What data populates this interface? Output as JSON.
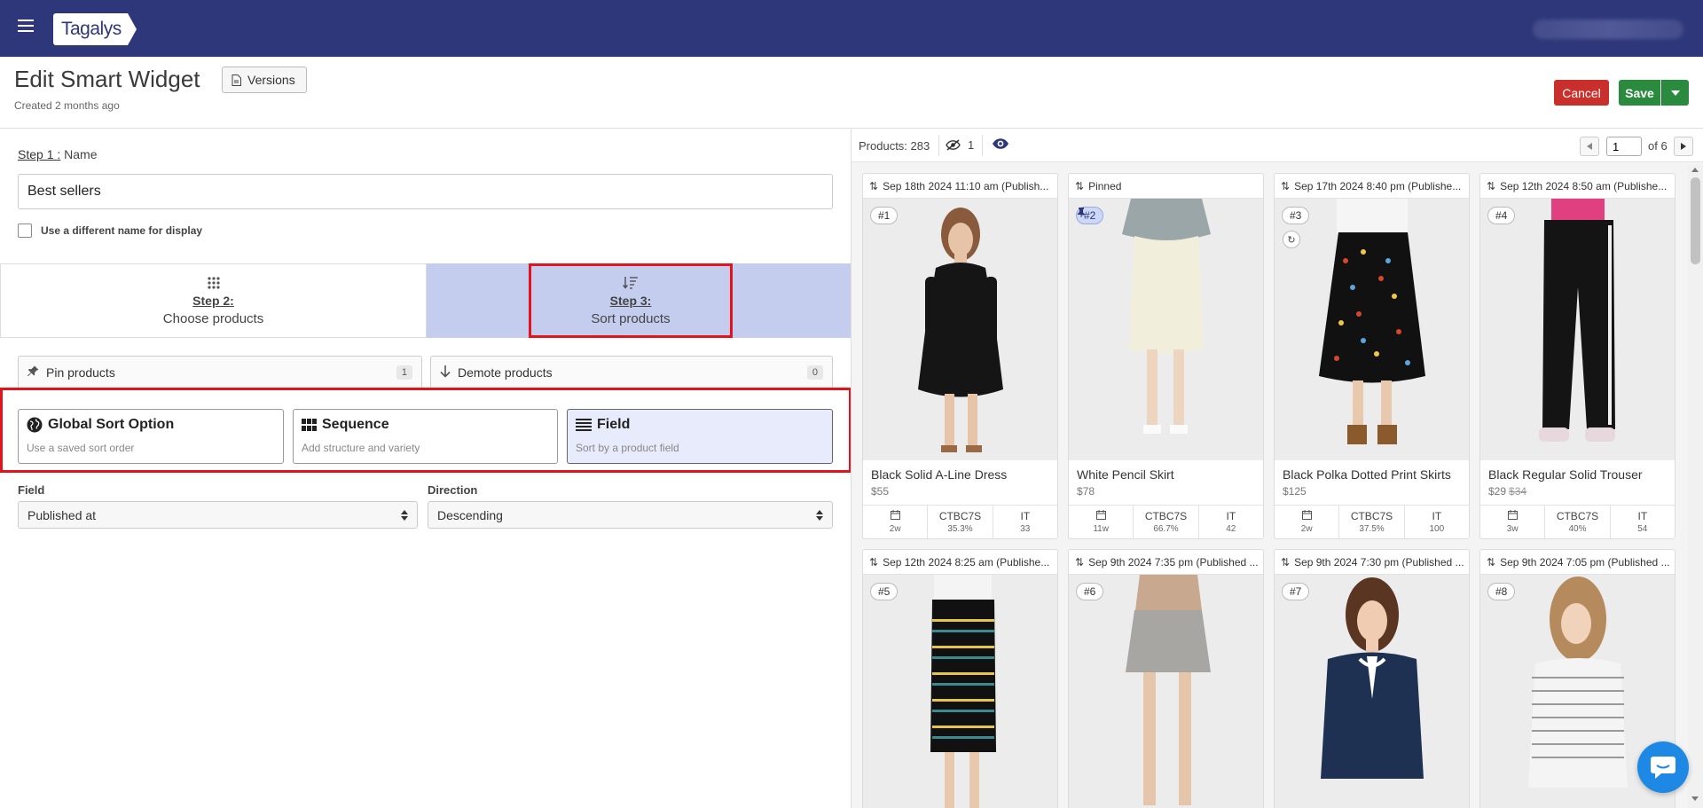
{
  "app": {
    "logo": "Tagalys"
  },
  "header": {
    "title": "Edit Smart Widget",
    "versions_label": "Versions",
    "created": "Created 2 months ago",
    "cancel_label": "Cancel",
    "save_label": "Save"
  },
  "step1": {
    "step_label": "Step 1 :",
    "label": "Name",
    "name_value": "Best sellers",
    "display_name_checkbox": "Use a different name for display"
  },
  "steps": [
    {
      "title": "Step 2:",
      "subtitle": "Choose products"
    },
    {
      "title": "Step 3:",
      "subtitle": "Sort products"
    }
  ],
  "pin_demote": [
    {
      "label": "Pin products",
      "count": "1"
    },
    {
      "label": "Demote products",
      "count": "0"
    }
  ],
  "sort_options": [
    {
      "title": "Global Sort Option",
      "subtitle": "Use a saved sort order"
    },
    {
      "title": "Sequence",
      "subtitle": "Add structure and variety"
    },
    {
      "title": "Field",
      "subtitle": "Sort by a product field"
    }
  ],
  "sort_config": {
    "field_label": "Field",
    "field_value": "Published at",
    "direction_label": "Direction",
    "direction_value": "Descending"
  },
  "product_bar": {
    "products_label": "Products:",
    "products_count": "283",
    "hidden_count": "1",
    "page_value": "1",
    "page_of": "of 6"
  },
  "products": [
    {
      "header": "Sep 18th 2024 11:10 am (Publish...",
      "rank": "#1",
      "name": "Black Solid A-Line Dress",
      "price": "$55",
      "old_price": "",
      "age": "2w",
      "ctbc": "35.3%",
      "it": "33"
    },
    {
      "header": "Pinned",
      "rank": "#2",
      "name": "White Pencil Skirt",
      "price": "$78",
      "old_price": "",
      "age": "11w",
      "ctbc": "66.7%",
      "it": "42"
    },
    {
      "header": "Sep 17th 2024 8:40 pm (Publishe...",
      "rank": "#3",
      "name": "Black Polka Dotted Print Skirts",
      "price": "$125",
      "old_price": "",
      "age": "2w",
      "ctbc": "37.5%",
      "it": "100"
    },
    {
      "header": "Sep 12th 2024 8:50 am (Publishe...",
      "rank": "#4",
      "name": "Black Regular Solid Trouser",
      "price": "$29",
      "old_price": "$34",
      "age": "3w",
      "ctbc": "40%",
      "it": "54"
    },
    {
      "header": "Sep 12th 2024 8:25 am (Publishe...",
      "rank": "#5"
    },
    {
      "header": "Sep 9th 2024 7:35 pm (Published ...",
      "rank": "#6"
    },
    {
      "header": "Sep 9th 2024 7:30 pm (Published ...",
      "rank": "#7"
    },
    {
      "header": "Sep 9th 2024 7:05 pm (Published ...",
      "rank": "#8"
    }
  ],
  "stat_labels": {
    "ctbc": "CTBC7S",
    "it": "IT"
  },
  "colors": {
    "topbar": "#2e3779",
    "highlight": "#e3121b",
    "active_tab": "#c5cdee",
    "cancel": "#c9302c",
    "save": "#2a8a3e"
  }
}
